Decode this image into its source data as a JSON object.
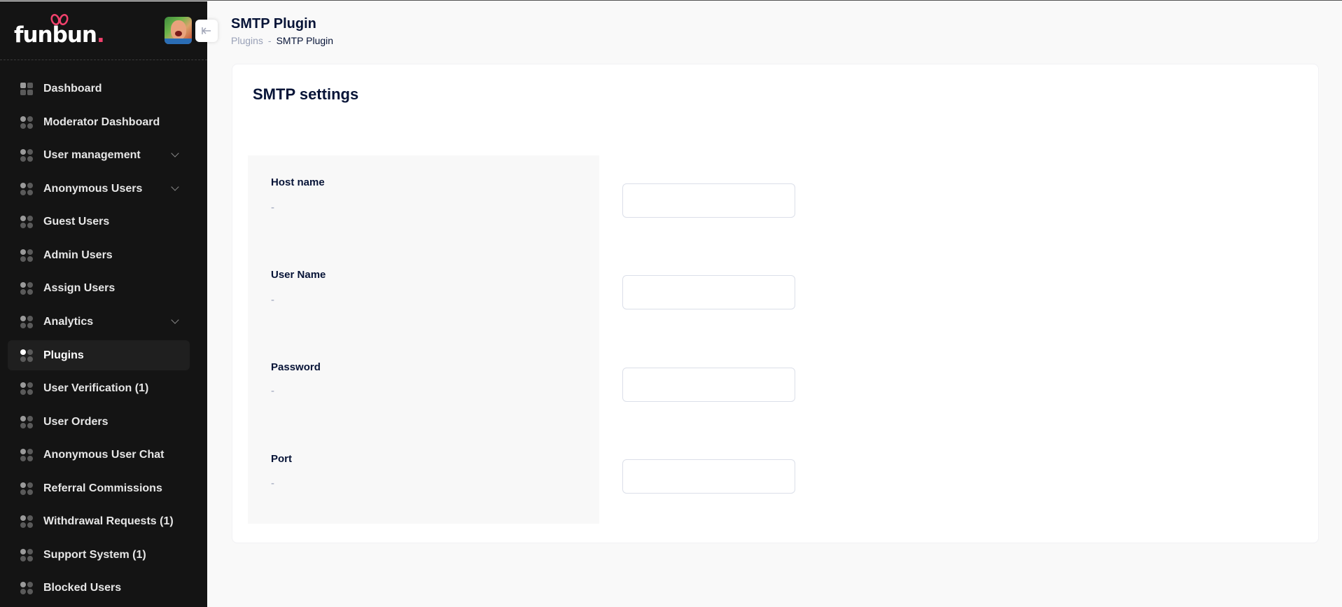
{
  "brand": {
    "logo_text": "funbun",
    "logo_dot": ".",
    "accent_color": "#f1416c"
  },
  "sidebar": {
    "items": [
      {
        "label": "Dashboard",
        "icon": "dashboard-icon",
        "expandable": false,
        "active": false
      },
      {
        "label": "Moderator Dashboard",
        "icon": "grid-icon",
        "expandable": false,
        "active": false
      },
      {
        "label": "User management",
        "icon": "grid-icon",
        "expandable": true,
        "active": false
      },
      {
        "label": "Anonymous Users",
        "icon": "grid-icon",
        "expandable": true,
        "active": false
      },
      {
        "label": "Guest Users",
        "icon": "grid-icon",
        "expandable": false,
        "active": false
      },
      {
        "label": "Admin Users",
        "icon": "grid-icon",
        "expandable": false,
        "active": false
      },
      {
        "label": "Assign Users",
        "icon": "grid-icon",
        "expandable": false,
        "active": false
      },
      {
        "label": "Analytics",
        "icon": "grid-icon",
        "expandable": true,
        "active": false
      },
      {
        "label": "Plugins",
        "icon": "grid-icon",
        "expandable": false,
        "active": true
      },
      {
        "label": "User Verification (1)",
        "icon": "grid-icon",
        "expandable": false,
        "active": false
      },
      {
        "label": "User Orders",
        "icon": "grid-icon",
        "expandable": false,
        "active": false
      },
      {
        "label": "Anonymous User Chat",
        "icon": "grid-icon",
        "expandable": false,
        "active": false
      },
      {
        "label": "Referral Commissions",
        "icon": "grid-icon",
        "expandable": false,
        "active": false
      },
      {
        "label": "Withdrawal Requests (1)",
        "icon": "grid-icon",
        "expandable": false,
        "active": false
      },
      {
        "label": "Support System (1)",
        "icon": "grid-icon",
        "expandable": false,
        "active": false
      },
      {
        "label": "Blocked Users",
        "icon": "grid-icon",
        "expandable": false,
        "active": false
      }
    ]
  },
  "header": {
    "title": "SMTP Plugin",
    "breadcrumb": {
      "parent": "Plugins",
      "separator": "-",
      "current": "SMTP Plugin"
    }
  },
  "card": {
    "title": "SMTP settings",
    "fields": [
      {
        "label": "Host name",
        "hint": "-",
        "value": "",
        "placeholder": ""
      },
      {
        "label": "User Name",
        "hint": "-",
        "value": "",
        "placeholder": ""
      },
      {
        "label": "Password",
        "hint": "-",
        "value": "",
        "placeholder": ""
      },
      {
        "label": "Port",
        "hint": "-",
        "value": "",
        "placeholder": ""
      }
    ]
  }
}
